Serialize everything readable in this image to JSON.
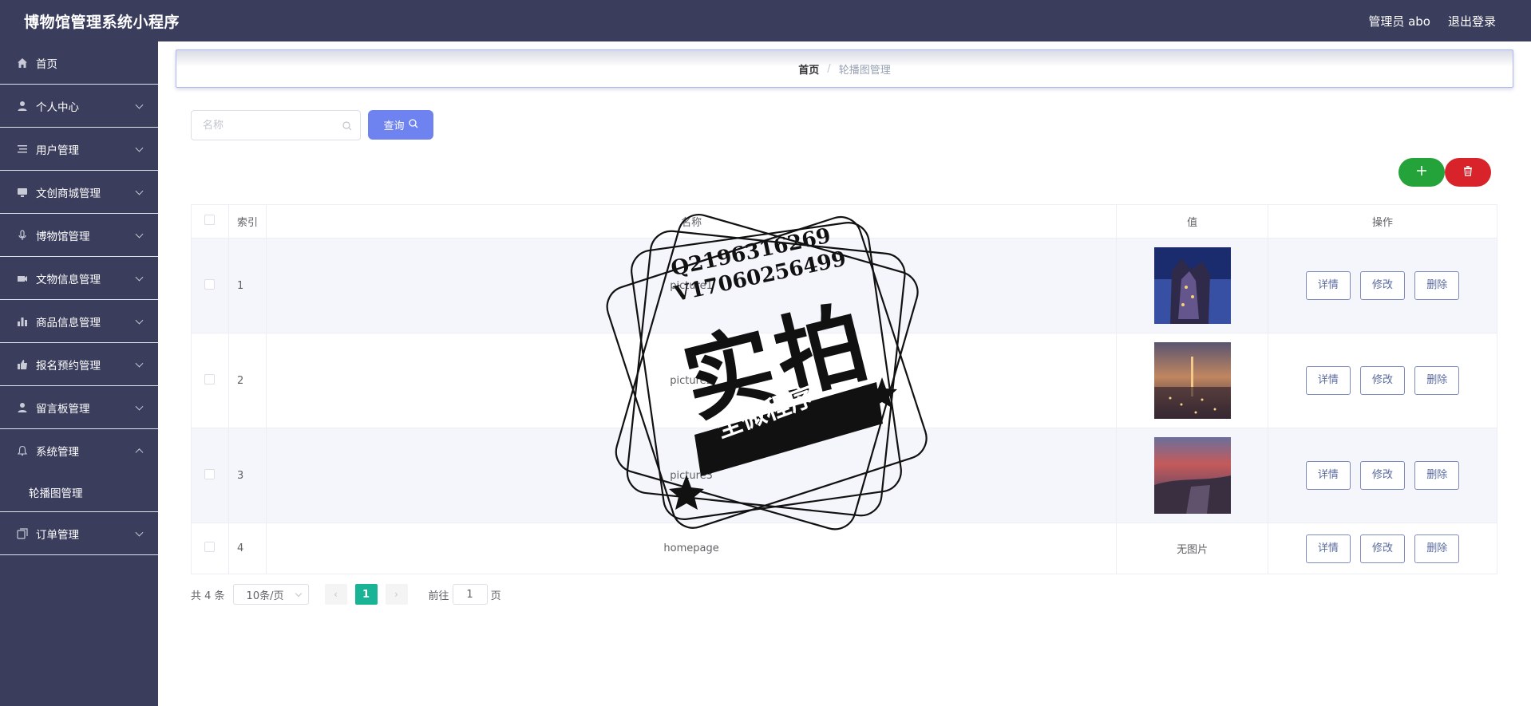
{
  "header": {
    "title": "博物馆管理系统小程序",
    "user_label": "管理员 abo",
    "logout_label": "退出登录"
  },
  "sidebar": {
    "items": [
      {
        "label": "首页",
        "icon": "home-icon"
      },
      {
        "label": "个人中心",
        "icon": "person-icon"
      },
      {
        "label": "用户管理",
        "icon": "list-icon"
      },
      {
        "label": "文创商城管理",
        "icon": "monitor-icon"
      },
      {
        "label": "博物馆管理",
        "icon": "microphone-icon"
      },
      {
        "label": "文物信息管理",
        "icon": "camera-icon"
      },
      {
        "label": "商品信息管理",
        "icon": "bar-chart-icon"
      },
      {
        "label": "报名预约管理",
        "icon": "thumb-up-icon"
      },
      {
        "label": "留言板管理",
        "icon": "user-icon"
      },
      {
        "label": "系统管理",
        "icon": "bell-icon"
      },
      {
        "label": "订单管理",
        "icon": "copy-icon"
      }
    ],
    "submenu": {
      "label": "轮播图管理"
    }
  },
  "breadcrumb": {
    "home": "首页",
    "separator": "/",
    "current": "轮播图管理"
  },
  "search": {
    "placeholder": "名称",
    "query_label": "查询"
  },
  "actions": {
    "add_icon": "plus-icon",
    "delete_icon": "trash-icon"
  },
  "table": {
    "headers": {
      "index": "索引",
      "name": "名称",
      "value": "值",
      "ops": "操作"
    },
    "rows": [
      {
        "index": "1",
        "name": "picture1",
        "value_type": "image",
        "colors": [
          "#1b2c6e",
          "#4f6fcf"
        ]
      },
      {
        "index": "2",
        "name": "picture2",
        "value_type": "image",
        "colors": [
          "#2a2238",
          "#c08660"
        ]
      },
      {
        "index": "3",
        "name": "picture3",
        "value_type": "image",
        "colors": [
          "#c55a5a",
          "#2b3d6b"
        ]
      },
      {
        "index": "4",
        "name": "homepage",
        "value_type": "text",
        "value_text": "无图片"
      }
    ],
    "ops": {
      "detail": "详情",
      "edit": "修改",
      "delete": "删除"
    }
  },
  "pagination": {
    "total": "共 4 条",
    "page_size": "10条/页",
    "current_page": "1",
    "goto_prefix": "前往",
    "goto_value": "1",
    "goto_suffix": "页"
  },
  "watermark": {
    "line1": "Q2196316269",
    "line2": "V17060256499",
    "big": "实拍",
    "ribbon": "全微程序"
  },
  "colors": {
    "header_bg": "#3a3d5c",
    "query_button": "#6f83f0",
    "add_button": "#23a33a",
    "delete_button": "#d9232a",
    "active_page": "#19b496"
  }
}
